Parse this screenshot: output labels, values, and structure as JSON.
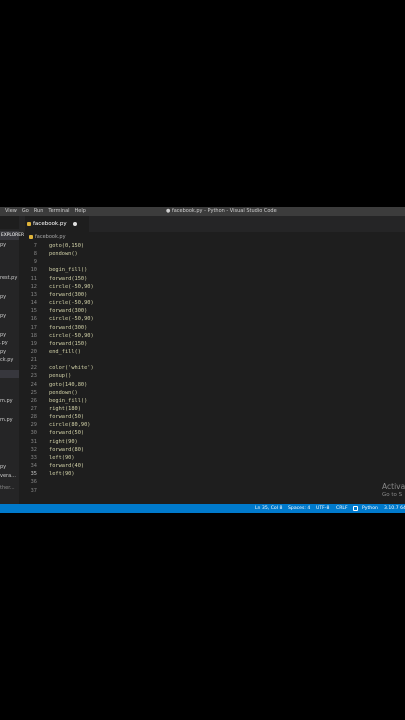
{
  "window": {
    "title": "● facebook.py - Python - Visual Studio Code"
  },
  "menubar": {
    "items": [
      "View",
      "Go",
      "Run",
      "Terminal",
      "Help"
    ]
  },
  "tab": {
    "label": "facebook.py"
  },
  "breadcrumb": {
    "file": "facebook.py"
  },
  "sidebar": {
    "header": "EXPLORER",
    "items": [
      "py",
      "rest.py",
      "py",
      "py",
      "py",
      ".py",
      "py",
      "ck.py",
      "",
      "m.py",
      "m.py",
      "py",
      "vera...",
      "ther..."
    ]
  },
  "editor": {
    "lines": [
      {
        "n": "7",
        "code": "goto(0,150)"
      },
      {
        "n": "8",
        "code": "pendown()"
      },
      {
        "n": "9",
        "code": ""
      },
      {
        "n": "10",
        "code": "begin_fill()"
      },
      {
        "n": "11",
        "code": "forward(150)"
      },
      {
        "n": "12",
        "code": "circle(-50,90)"
      },
      {
        "n": "13",
        "code": "forward(300)"
      },
      {
        "n": "14",
        "code": "circle(-50,90)"
      },
      {
        "n": "15",
        "code": "forward(300)"
      },
      {
        "n": "16",
        "code": "circle(-50,90)"
      },
      {
        "n": "17",
        "code": "forward(300)"
      },
      {
        "n": "18",
        "code": "circle(-50,90)"
      },
      {
        "n": "19",
        "code": "forward(150)"
      },
      {
        "n": "20",
        "code": "end_fill()"
      },
      {
        "n": "21",
        "code": ""
      },
      {
        "n": "22",
        "code": "color('white')"
      },
      {
        "n": "23",
        "code": "penup()"
      },
      {
        "n": "24",
        "code": "goto(140,80)"
      },
      {
        "n": "25",
        "code": "pendown()"
      },
      {
        "n": "26",
        "code": "begin_fill()"
      },
      {
        "n": "27",
        "code": "right(180)"
      },
      {
        "n": "28",
        "code": "forward(50)"
      },
      {
        "n": "29",
        "code": "circle(80,90)"
      },
      {
        "n": "30",
        "code": "forward(50)"
      },
      {
        "n": "31",
        "code": "right(90)"
      },
      {
        "n": "32",
        "code": "forward(80)"
      },
      {
        "n": "33",
        "code": "left(90)"
      },
      {
        "n": "34",
        "code": "forward(40)"
      },
      {
        "n": "35",
        "code": "left(90)"
      },
      {
        "n": "36",
        "code": ""
      },
      {
        "n": "37",
        "code": ""
      }
    ]
  },
  "watermark": {
    "line1": "Activa",
    "line2": "Go to S"
  },
  "statusbar": {
    "position": "Ln 35, Col 8",
    "spaces": "Spaces: 4",
    "encoding": "UTF-8",
    "eol": "CRLF",
    "language": "Python",
    "version": "3.10.7 64"
  },
  "colors": {
    "status": "#007acc",
    "editor_bg": "#1e1e1e",
    "sidebar_bg": "#252526",
    "menubar_bg": "#3c3c3c"
  }
}
